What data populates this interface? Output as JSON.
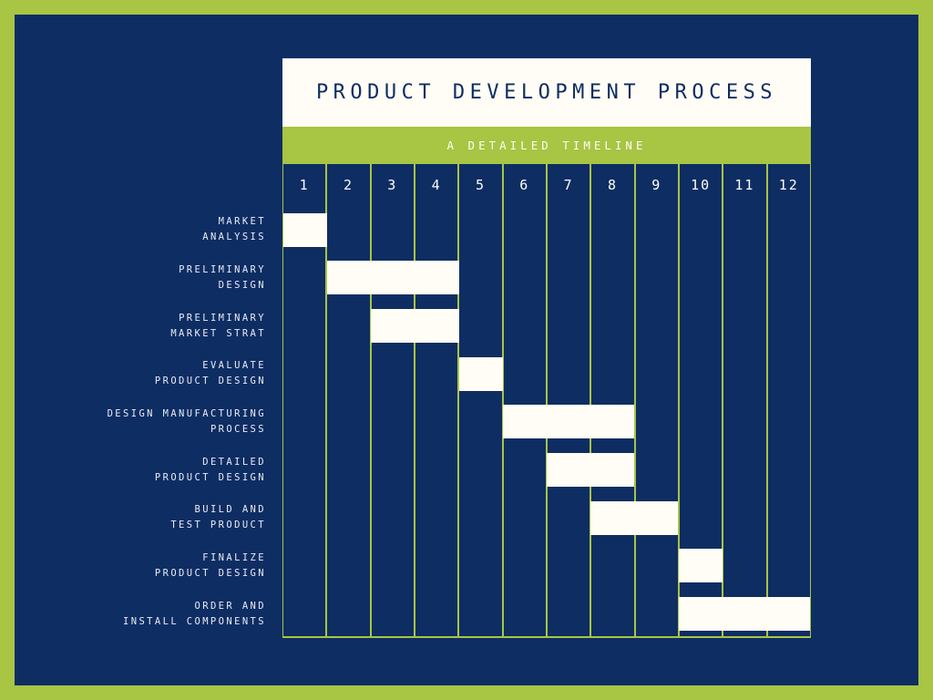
{
  "theme": {
    "frame_green": "#a8c543",
    "canvas_navy": "#0e2d63",
    "bar_cream": "#fffdf5",
    "label_text": "#e8ecf4"
  },
  "header": {
    "title": "PRODUCT DEVELOPMENT PROCESS",
    "subtitle": "A DETAILED TIMELINE"
  },
  "chart_data": {
    "type": "bar",
    "title": "PRODUCT DEVELOPMENT PROCESS",
    "subtitle": "A DETAILED TIMELINE",
    "xlabel": "",
    "ylabel": "",
    "xlim": [
      1,
      12
    ],
    "grid": true,
    "legend": "none",
    "orientation": "horizontal-gantt",
    "columns": [
      "1",
      "2",
      "3",
      "4",
      "5",
      "6",
      "7",
      "8",
      "9",
      "10",
      "11",
      "12"
    ],
    "categories": [
      "MARKET ANALYSIS",
      "PRELIMINARY DESIGN",
      "PRELIMINARY MARKET STRAT",
      "EVALUATE PRODUCT DESIGN",
      "DESIGN MANUFACTURING PROCESS",
      "DETAILED PRODUCT DESIGN",
      "BUILD AND TEST PRODUCT",
      "FINALIZE PRODUCT DESIGN",
      "ORDER AND INSTALL COMPONENTS"
    ],
    "tasks": [
      {
        "label_line1": "MARKET",
        "label_line2": "ANALYSIS",
        "start_month": 1,
        "end_month": 1,
        "duration": 1
      },
      {
        "label_line1": "PRELIMINARY",
        "label_line2": "DESIGN",
        "start_month": 2,
        "end_month": 4,
        "duration": 3
      },
      {
        "label_line1": "PRELIMINARY",
        "label_line2": "MARKET STRAT",
        "start_month": 3,
        "end_month": 4,
        "duration": 2
      },
      {
        "label_line1": "EVALUATE",
        "label_line2": "PRODUCT DESIGN",
        "start_month": 5,
        "end_month": 5,
        "duration": 1
      },
      {
        "label_line1": "DESIGN MANUFACTURING",
        "label_line2": "PROCESS",
        "start_month": 6,
        "end_month": 8,
        "duration": 3
      },
      {
        "label_line1": "DETAILED",
        "label_line2": "PRODUCT DESIGN",
        "start_month": 7,
        "end_month": 8,
        "duration": 2
      },
      {
        "label_line1": "BUILD AND",
        "label_line2": "TEST PRODUCT",
        "start_month": 8,
        "end_month": 9,
        "duration": 2
      },
      {
        "label_line1": "FINALIZE",
        "label_line2": "PRODUCT DESIGN",
        "start_month": 10,
        "end_month": 10,
        "duration": 1
      },
      {
        "label_line1": "ORDER AND",
        "label_line2": "INSTALL COMPONENTS",
        "start_month": 10,
        "end_month": 12,
        "duration": 3
      }
    ]
  }
}
